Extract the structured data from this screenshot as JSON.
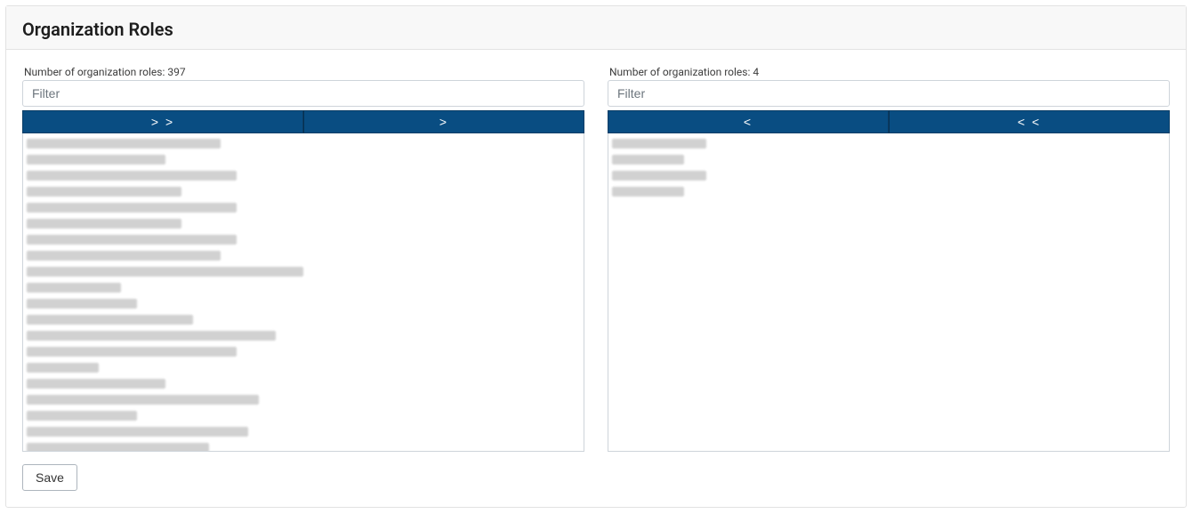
{
  "header": {
    "title": "Organization Roles"
  },
  "left": {
    "count_label": "Number of organization roles: 397",
    "filter_placeholder": "Filter",
    "btn_move_all": "> >",
    "btn_move_one": ">",
    "item_widths": [
      "w35",
      "w25",
      "w38",
      "w28",
      "w38",
      "w28",
      "w38",
      "w35",
      "w50",
      "w17",
      "w20",
      "w30",
      "w45",
      "w38",
      "w13",
      "w25",
      "w42",
      "w20",
      "w40",
      "w33"
    ]
  },
  "right": {
    "count_label": "Number of organization roles: 4",
    "filter_placeholder": "Filter",
    "btn_move_one": "<",
    "btn_move_all": "< <",
    "item_widths": [
      "w17",
      "w13",
      "w17",
      "w13"
    ]
  },
  "footer": {
    "save_label": "Save"
  }
}
